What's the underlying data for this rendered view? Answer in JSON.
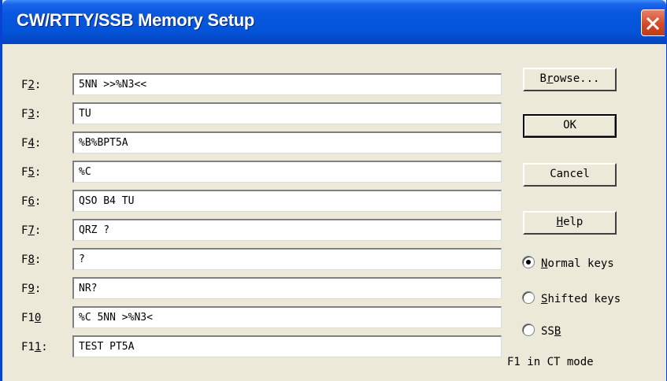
{
  "window": {
    "title": "CW/RTTY/SSB Memory Setup"
  },
  "memories": [
    {
      "pre": "F",
      "u": "2",
      "post": ":",
      "value": "5NN >>%N3<<"
    },
    {
      "pre": "F",
      "u": "3",
      "post": ":",
      "value": "TU"
    },
    {
      "pre": "F",
      "u": "4",
      "post": ":",
      "value": "%B%BPT5A"
    },
    {
      "pre": "F",
      "u": "5",
      "post": ":",
      "value": "%C"
    },
    {
      "pre": "F",
      "u": "6",
      "post": ":",
      "value": "QSO B4 TU"
    },
    {
      "pre": "F",
      "u": "7",
      "post": ":",
      "value": "QRZ ?"
    },
    {
      "pre": "F",
      "u": "8",
      "post": ":",
      "value": "?"
    },
    {
      "pre": "F",
      "u": "9",
      "post": ":",
      "value": "NR?"
    },
    {
      "pre": "F1",
      "u": "0",
      "post": "",
      "value": "%C 5NN >%N3<"
    },
    {
      "pre": "F1",
      "u": "1",
      "post": ":",
      "value": "TEST PT5A"
    }
  ],
  "buttons": {
    "browse": {
      "pre": "B",
      "u": "r",
      "post": "owse..."
    },
    "ok": "OK",
    "cancel": "Cancel",
    "help": {
      "pre": "",
      "u": "H",
      "post": "elp"
    }
  },
  "keymode": {
    "normal": {
      "pre": "",
      "u": "N",
      "post": "ormal keys",
      "selected": true
    },
    "shifted": {
      "pre": "",
      "u": "S",
      "post": "hifted keys",
      "selected": false
    },
    "ssb": {
      "pre": "SS",
      "u": "B",
      "post": "",
      "selected": false
    }
  },
  "f1_note": "F1 in CT mode",
  "colors": {
    "titlebar": "#0454d9",
    "close": "#d44a26",
    "face": "#ece9d8"
  }
}
